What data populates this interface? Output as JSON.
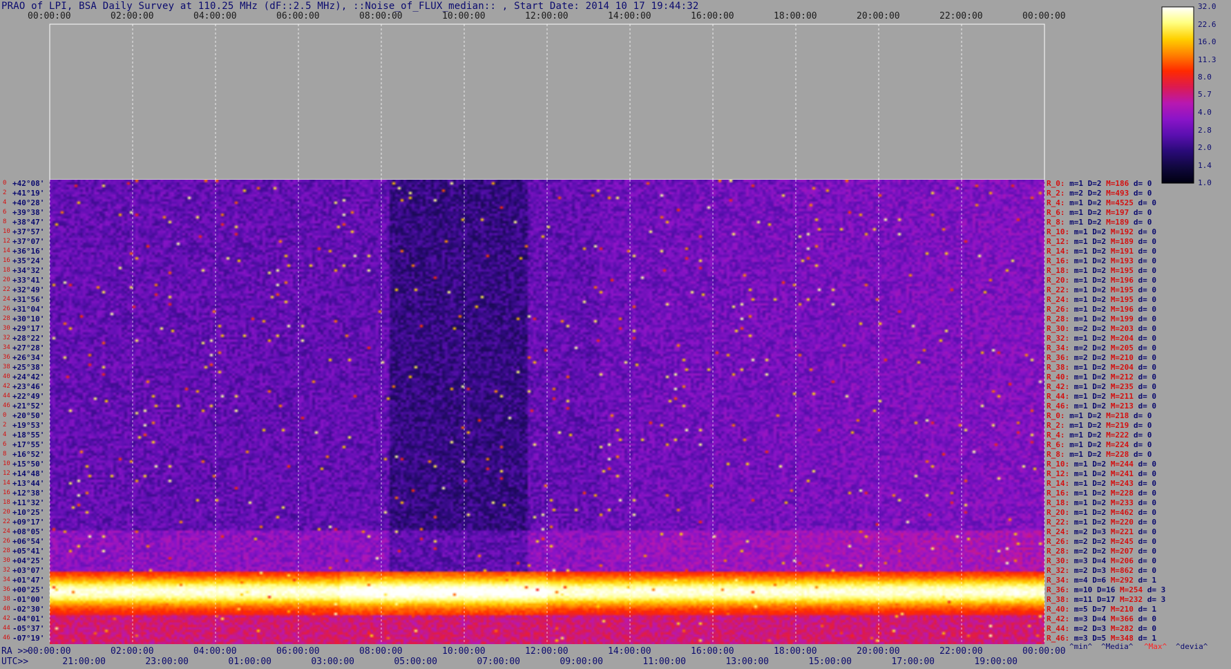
{
  "title": "PRAO of LPI, BSA Daily Survey at 110.25 MHz (dF::2.5 MHz), ::Noise_of_FLUX_median:: , Start Date: 2014 10 17 19:44:32",
  "chart_data": {
    "type": "heatmap",
    "top_ticks": [
      "00:00:00",
      "02:00:00",
      "04:00:00",
      "06:00:00",
      "08:00:00",
      "10:00:00",
      "12:00:00",
      "14:00:00",
      "16:00:00",
      "18:00:00",
      "20:00:00",
      "22:00:00",
      "00:00:00"
    ],
    "ra_label": "RA >>",
    "ra_ticks": [
      "00:00:00",
      "02:00:00",
      "04:00:00",
      "06:00:00",
      "08:00:00",
      "10:00:00",
      "12:00:00",
      "14:00:00",
      "16:00:00",
      "18:00:00",
      "20:00:00",
      "22:00:00",
      "00:00:00"
    ],
    "utc_label": "UTC>>",
    "utc_ticks": [
      "21:00:00",
      "23:00:00",
      "01:00:00",
      "03:00:00",
      "05:00:00",
      "07:00:00",
      "09:00:00",
      "11:00:00",
      "13:00:00",
      "15:00:00",
      "17:00:00",
      "19:00:00"
    ],
    "declinations": [
      "+42°08'",
      "+41°19'",
      "+40°28'",
      "+39°38'",
      "+38°47'",
      "+37°57'",
      "+37°07'",
      "+36°16'",
      "+35°24'",
      "+34°32'",
      "+33°41'",
      "+32°49'",
      "+31°56'",
      "+31°04'",
      "+30°10'",
      "+29°17'",
      "+28°22'",
      "+27°28'",
      "+26°34'",
      "+25°38'",
      "+24°42'",
      "+23°46'",
      "+22°49'",
      "+21°52'",
      "+20°50'",
      "+19°53'",
      "+18°55'",
      "+17°55'",
      "+16°52'",
      "+15°50'",
      "+14°48'",
      "+13°44'",
      "+12°38'",
      "+11°32'",
      "+10°25'",
      "+09°17'",
      "+08°05'",
      "+06°54'",
      "+05°41'",
      "+04°25'",
      "+03°07'",
      "+01°47'",
      "+00°25'",
      "-01°00'",
      "-02°30'",
      "-04°01'",
      "-05°37'",
      "-07°19'"
    ],
    "row_numbers": [
      "0",
      "2",
      "4",
      "6",
      "8",
      "10",
      "12",
      "14",
      "16",
      "18",
      "20",
      "22",
      "24",
      "26",
      "28",
      "30",
      "32",
      "34",
      "36",
      "38",
      "40",
      "42",
      "44",
      "46",
      "0",
      "2",
      "4",
      "6",
      "8",
      "10",
      "12",
      "14",
      "16",
      "18",
      "20",
      "22",
      "24",
      "26",
      "28",
      "30",
      "32",
      "34",
      "36",
      "38",
      "40",
      "42",
      "44",
      "46"
    ],
    "rows": [
      {
        "r": "R_0:",
        "m": "m=1",
        "d": "D=2",
        "M": "M=186",
        "dv": "d= 0"
      },
      {
        "r": "R_2:",
        "m": "m=2",
        "d": "D=2",
        "M": "M=493",
        "dv": "d= 0"
      },
      {
        "r": "R_4:",
        "m": "m=1",
        "d": "D=2",
        "M": "M=4525",
        "dv": "d= 0"
      },
      {
        "r": "R_6:",
        "m": "m=1",
        "d": "D=2",
        "M": "M=197",
        "dv": "d= 0"
      },
      {
        "r": "R_8:",
        "m": "m=1",
        "d": "D=2",
        "M": "M=189",
        "dv": "d= 0"
      },
      {
        "r": "R_10:",
        "m": "m=1",
        "d": "D=2",
        "M": "M=192",
        "dv": "d= 0"
      },
      {
        "r": "R_12:",
        "m": "m=1",
        "d": "D=2",
        "M": "M=189",
        "dv": "d= 0"
      },
      {
        "r": "R_14:",
        "m": "m=1",
        "d": "D=2",
        "M": "M=191",
        "dv": "d= 0"
      },
      {
        "r": "R_16:",
        "m": "m=1",
        "d": "D=2",
        "M": "M=193",
        "dv": "d= 0"
      },
      {
        "r": "R_18:",
        "m": "m=1",
        "d": "D=2",
        "M": "M=195",
        "dv": "d= 0"
      },
      {
        "r": "R_20:",
        "m": "m=1",
        "d": "D=2",
        "M": "M=196",
        "dv": "d= 0"
      },
      {
        "r": "R_22:",
        "m": "m=1",
        "d": "D=2",
        "M": "M=195",
        "dv": "d= 0"
      },
      {
        "r": "R_24:",
        "m": "m=1",
        "d": "D=2",
        "M": "M=195",
        "dv": "d= 0"
      },
      {
        "r": "R_26:",
        "m": "m=1",
        "d": "D=2",
        "M": "M=196",
        "dv": "d= 0"
      },
      {
        "r": "R_28:",
        "m": "m=1",
        "d": "D=2",
        "M": "M=199",
        "dv": "d= 0"
      },
      {
        "r": "R_30:",
        "m": "m=2",
        "d": "D=2",
        "M": "M=203",
        "dv": "d= 0"
      },
      {
        "r": "R_32:",
        "m": "m=1",
        "d": "D=2",
        "M": "M=204",
        "dv": "d= 0"
      },
      {
        "r": "R_34:",
        "m": "m=2",
        "d": "D=2",
        "M": "M=205",
        "dv": "d= 0"
      },
      {
        "r": "R_36:",
        "m": "m=2",
        "d": "D=2",
        "M": "M=210",
        "dv": "d= 0"
      },
      {
        "r": "R_38:",
        "m": "m=1",
        "d": "D=2",
        "M": "M=204",
        "dv": "d= 0"
      },
      {
        "r": "R_40:",
        "m": "m=1",
        "d": "D=2",
        "M": "M=212",
        "dv": "d= 0"
      },
      {
        "r": "R_42:",
        "m": "m=1",
        "d": "D=2",
        "M": "M=235",
        "dv": "d= 0"
      },
      {
        "r": "R_44:",
        "m": "m=1",
        "d": "D=2",
        "M": "M=211",
        "dv": "d= 0"
      },
      {
        "r": "R_46:",
        "m": "m=1",
        "d": "D=2",
        "M": "M=213",
        "dv": "d= 0"
      },
      {
        "r": "R_0:",
        "m": "m=1",
        "d": "D=2",
        "M": "M=218",
        "dv": "d= 0"
      },
      {
        "r": "R_2:",
        "m": "m=1",
        "d": "D=2",
        "M": "M=219",
        "dv": "d= 0"
      },
      {
        "r": "R_4:",
        "m": "m=1",
        "d": "D=2",
        "M": "M=222",
        "dv": "d= 0"
      },
      {
        "r": "R_6:",
        "m": "m=1",
        "d": "D=2",
        "M": "M=224",
        "dv": "d= 0"
      },
      {
        "r": "R_8:",
        "m": "m=1",
        "d": "D=2",
        "M": "M=228",
        "dv": "d= 0"
      },
      {
        "r": "R_10:",
        "m": "m=1",
        "d": "D=2",
        "M": "M=244",
        "dv": "d= 0"
      },
      {
        "r": "R_12:",
        "m": "m=1",
        "d": "D=2",
        "M": "M=241",
        "dv": "d= 0"
      },
      {
        "r": "R_14:",
        "m": "m=1",
        "d": "D=2",
        "M": "M=243",
        "dv": "d= 0"
      },
      {
        "r": "R_16:",
        "m": "m=1",
        "d": "D=2",
        "M": "M=228",
        "dv": "d= 0"
      },
      {
        "r": "R_18:",
        "m": "m=1",
        "d": "D=2",
        "M": "M=233",
        "dv": "d= 0"
      },
      {
        "r": "R_20:",
        "m": "m=1",
        "d": "D=2",
        "M": "M=462",
        "dv": "d= 0"
      },
      {
        "r": "R_22:",
        "m": "m=1",
        "d": "D=2",
        "M": "M=220",
        "dv": "d= 0"
      },
      {
        "r": "R_24:",
        "m": "m=2",
        "d": "D=3",
        "M": "M=221",
        "dv": "d= 0"
      },
      {
        "r": "R_26:",
        "m": "m=2",
        "d": "D=2",
        "M": "M=245",
        "dv": "d= 0"
      },
      {
        "r": "R_28:",
        "m": "m=2",
        "d": "D=2",
        "M": "M=207",
        "dv": "d= 0"
      },
      {
        "r": "R_30:",
        "m": "m=3",
        "d": "D=4",
        "M": "M=206",
        "dv": "d= 0"
      },
      {
        "r": "R_32:",
        "m": "m=2",
        "d": "D=3",
        "M": "M=862",
        "dv": "d= 0"
      },
      {
        "r": "R_34:",
        "m": "m=4",
        "d": "D=6",
        "M": "M=292",
        "dv": "d= 1"
      },
      {
        "r": "R_36:",
        "m": "m=10",
        "d": "D=16",
        "M": "M=254",
        "dv": "d= 3"
      },
      {
        "r": "R_38:",
        "m": "m=11",
        "d": "D=17",
        "M": "M=232",
        "dv": "d= 3"
      },
      {
        "r": "R_40:",
        "m": "m=5",
        "d": "D=7",
        "M": "M=210",
        "dv": "d= 1"
      },
      {
        "r": "R_42:",
        "m": "m=3",
        "d": "D=4",
        "M": "M=366",
        "dv": "d= 0"
      },
      {
        "r": "R_44:",
        "m": "m=2",
        "d": "D=3",
        "M": "M=282",
        "dv": "d= 0"
      },
      {
        "r": "R_46:",
        "m": "m=3",
        "d": "D=5",
        "M": "M=348",
        "dv": "d= 1"
      }
    ],
    "stats_legend": {
      "min": "^min^",
      "media": "^Media^",
      "max": "^Max^",
      "devia": "^devia^"
    },
    "colorbar": {
      "ticks": [
        "32.0",
        "22.6",
        "16.0",
        "11.3",
        "8.0",
        "5.7",
        "4.0",
        "2.8",
        "2.0",
        "1.4",
        "1.0"
      ],
      "scale": "log",
      "range": [
        1.0,
        32.0
      ]
    }
  },
  "colors": {
    "background": "#a3a3a3",
    "title": "#0a0a6e",
    "label_red": "#d41010",
    "colormap": [
      "#000010",
      "#10083e",
      "#2a0a78",
      "#5a0fb0",
      "#8a14c8",
      "#b818b0",
      "#dc1a50",
      "#ff2a00",
      "#ff8000",
      "#ffd000",
      "#ffff80",
      "#ffffff"
    ]
  }
}
